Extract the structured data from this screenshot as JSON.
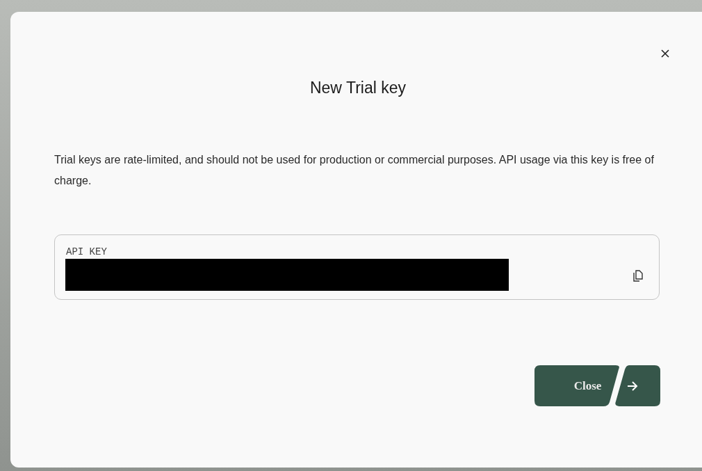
{
  "dialog": {
    "title": "New Trial key",
    "description": "Trial keys are rate-limited, and should not be used for production or commercial purposes. API usage via this key is free of charge.",
    "key_field": {
      "label": "API KEY",
      "redacted": true
    },
    "buttons": [
      {
        "label": "Close"
      }
    ]
  }
}
